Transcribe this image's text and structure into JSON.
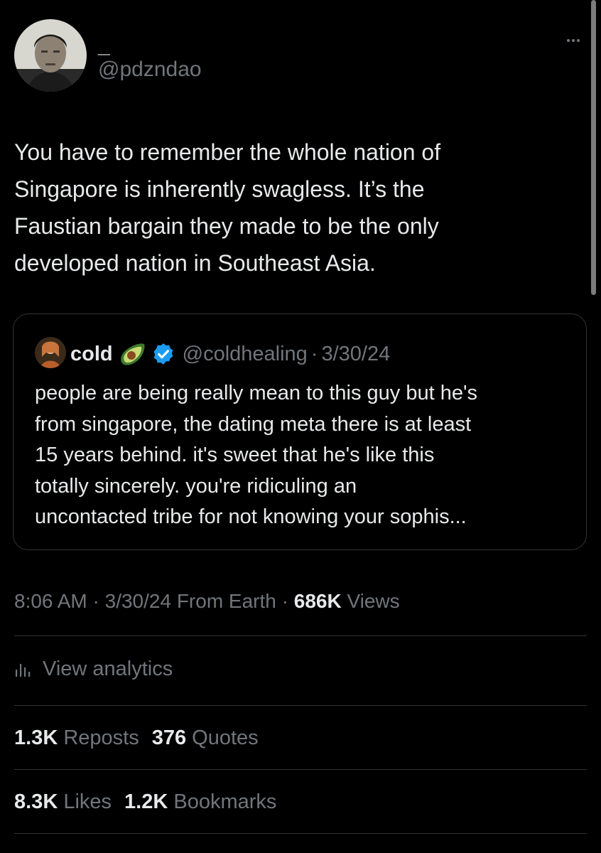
{
  "author": {
    "display_name": "_",
    "handle": "@pdzndao",
    "avatar": "avatar-photo"
  },
  "more_icon": "more-horizontal-icon",
  "tweet": {
    "text_lines": [
      "You have to remember the whole nation of",
      "Singapore is inherently swagless. It’s the",
      "Faustian bargain they made to be the only",
      "developed nation in Southeast Asia."
    ]
  },
  "quote": {
    "name": "cold",
    "emoji": "avocado-icon",
    "verified": "verified-badge-icon",
    "handle": "@coldhealing",
    "separator": "·",
    "date": "3/30/24",
    "text_lines": [
      "people are being really mean to this guy but he's",
      "from singapore, the dating meta there is at least",
      "15 years behind. it's sweet that he's like this",
      "totally sincerely. you're ridiculing an",
      "uncontacted tribe for not knowing your sophis..."
    ]
  },
  "meta": {
    "time": "8:06 AM",
    "sep1": "·",
    "date": "3/30/24",
    "source": "From Earth",
    "sep2": "·",
    "views_count": "686K",
    "views_label": "Views"
  },
  "analytics": {
    "icon": "analytics-icon",
    "label": "View analytics"
  },
  "stats": {
    "reposts_count": "1.3K",
    "reposts_label": "Reposts",
    "quotes_count": "376",
    "quotes_label": "Quotes",
    "likes_count": "8.3K",
    "likes_label": "Likes",
    "bookmarks_count": "1.2K",
    "bookmarks_label": "Bookmarks"
  },
  "colors": {
    "background": "#000000",
    "primary_text": "#e7e9ea",
    "secondary_text": "#71767b",
    "border": "#2f3336",
    "verified_blue": "#1d9bf0"
  }
}
